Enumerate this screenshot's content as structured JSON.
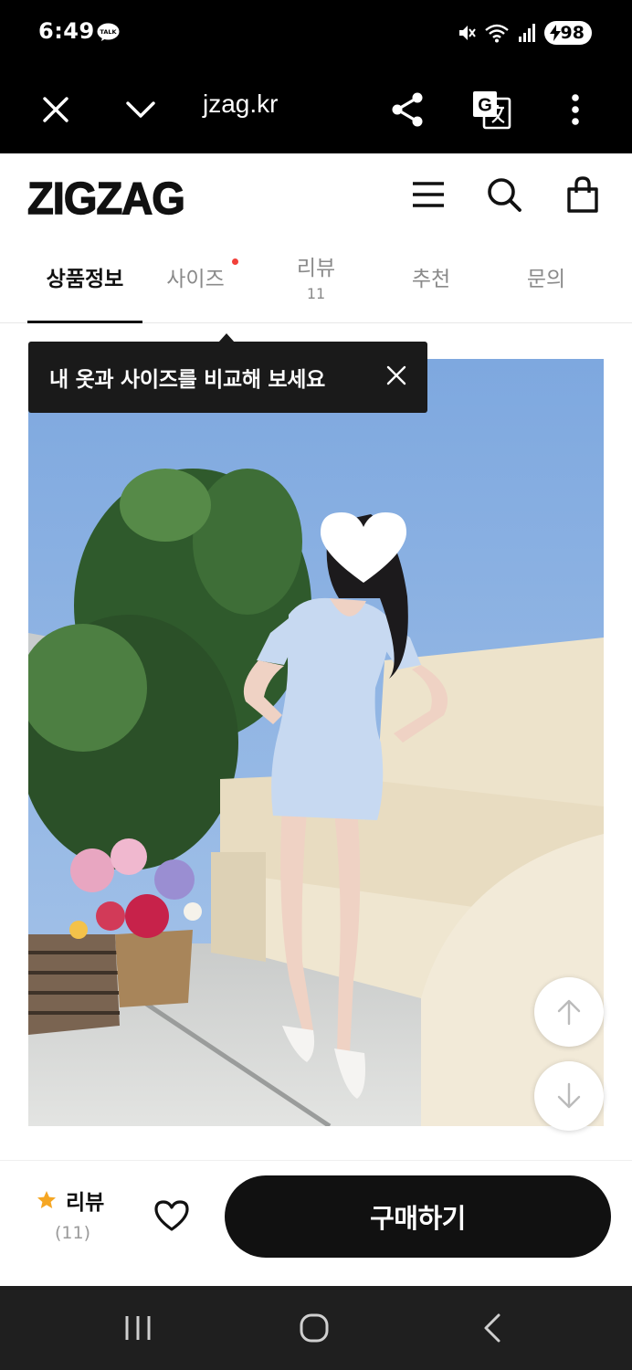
{
  "status_bar": {
    "time": "6:49",
    "talk_badge": "TALK",
    "battery": "98"
  },
  "browser": {
    "url": "jzag.kr"
  },
  "app": {
    "logo": "ZIGZAG"
  },
  "tabs": [
    {
      "label": "상품정보",
      "active": true
    },
    {
      "label": "사이즈",
      "has_dot": true
    },
    {
      "label": "리뷰",
      "sub": "11"
    },
    {
      "label": "추천"
    },
    {
      "label": "문의"
    }
  ],
  "tooltip": {
    "text": "내 옷과 사이즈를 비교해 보세요"
  },
  "bottom_bar": {
    "review_label": "리뷰",
    "review_count": "(11)",
    "buy_label": "구매하기"
  },
  "colors": {
    "accent": "#111111",
    "dot": "#f2403a",
    "star": "#f5a623",
    "sky": "#8fb3e0"
  }
}
